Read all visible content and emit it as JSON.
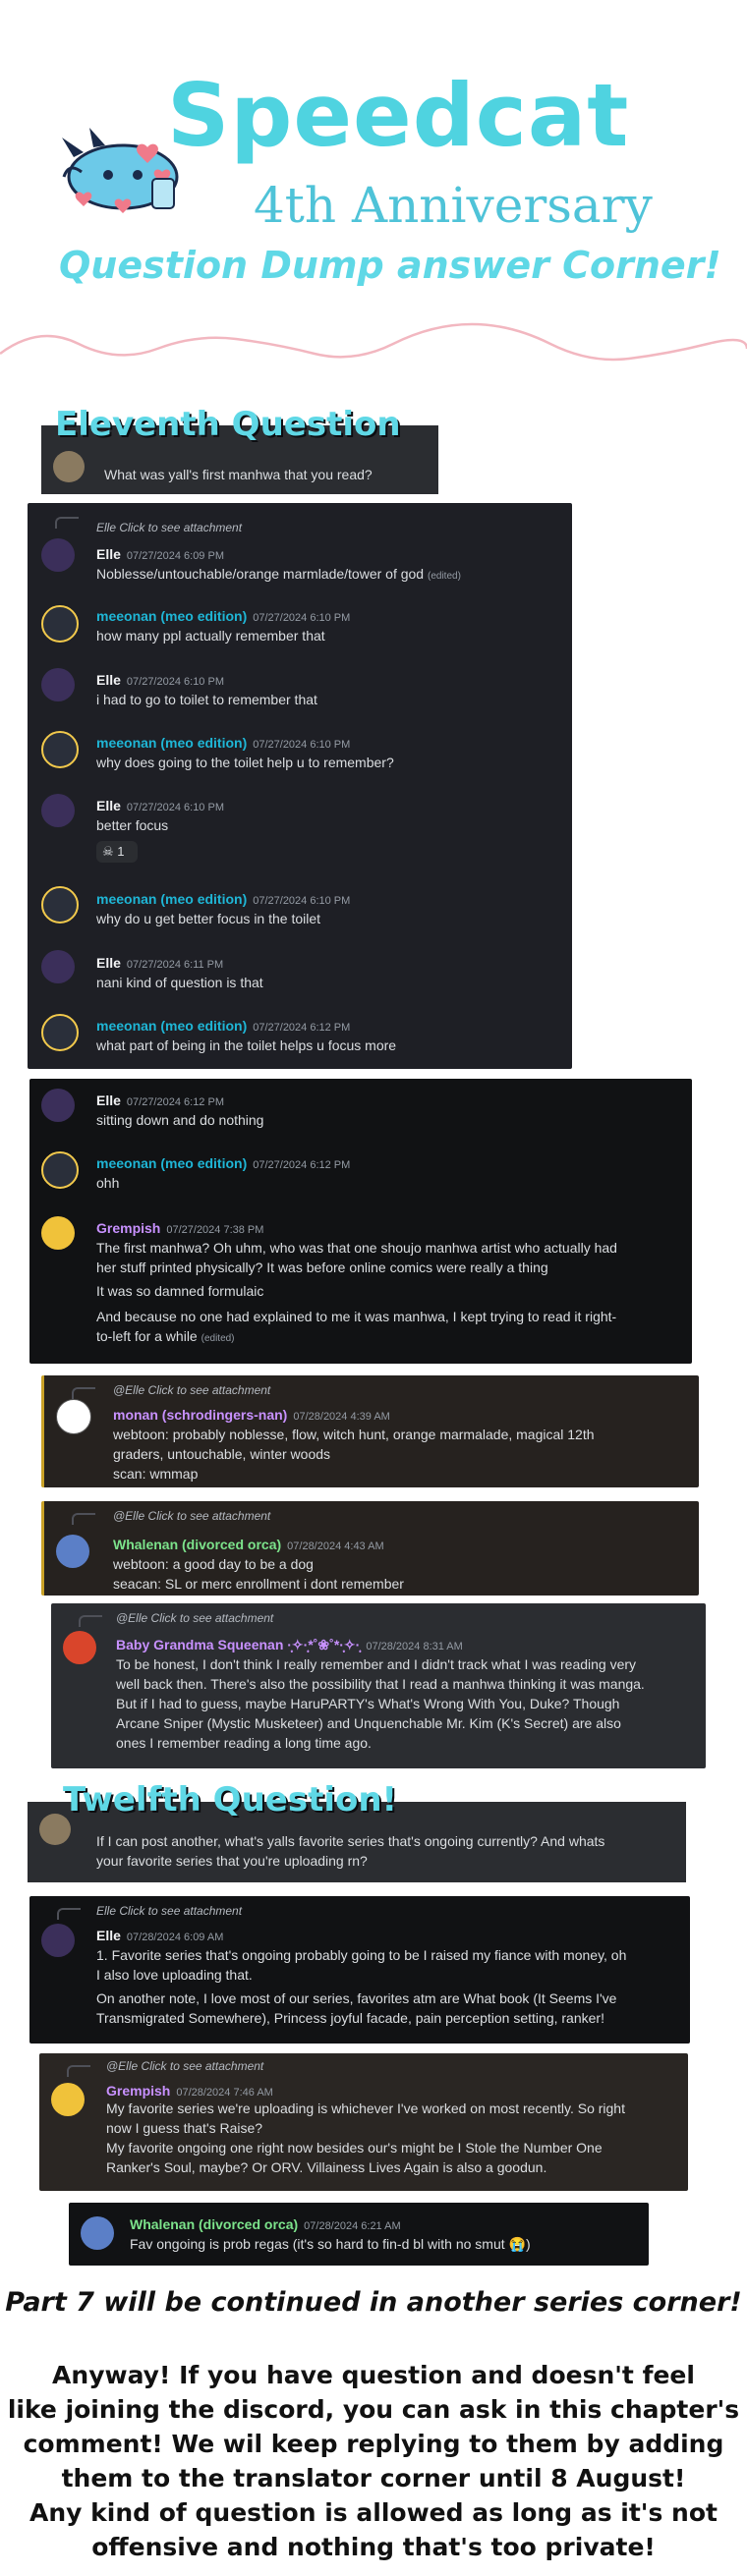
{
  "header": {
    "title": "Speedcat",
    "subtitle": "4th Anniversary",
    "tagline": "Question Dump answer Corner!"
  },
  "q11": {
    "heading": "Eleventh Question",
    "question": "What was yall's first manhwa that you read?"
  },
  "chat1": [
    {
      "reply": "Elle Click to see attachment",
      "name": "Elle",
      "time": "07/27/2024 6:09 PM",
      "text": "Noblesse/untouchable/orange marmlade/tower of god",
      "edited": "(edited)"
    },
    {
      "name": "meeonan (meo edition)",
      "time": "07/27/2024 6:10 PM",
      "text": "how many ppl actually remember that"
    },
    {
      "name": "Elle",
      "time": "07/27/2024 6:10 PM",
      "text": "i had to go to toilet to remember that"
    },
    {
      "name": "meeonan (meo edition)",
      "time": "07/27/2024 6:10 PM",
      "text": "why does going to the toilet help u to remember?"
    },
    {
      "name": "Elle",
      "time": "07/27/2024 6:10 PM",
      "text": "better focus",
      "reaction": "1"
    },
    {
      "name": "meeonan (meo edition)",
      "time": "07/27/2024 6:10 PM",
      "text": "why do u get better focus in the toilet"
    },
    {
      "name": "Elle",
      "time": "07/27/2024 6:11 PM",
      "text": "nani kind of question is that"
    },
    {
      "name": "meeonan (meo edition)",
      "time": "07/27/2024 6:12 PM",
      "text": "what part of being in the toilet helps u focus more"
    }
  ],
  "chat2": [
    {
      "name": "Elle",
      "time": "07/27/2024 6:12 PM",
      "text": "sitting down and do nothing"
    },
    {
      "name": "meeonan (meo edition)",
      "time": "07/27/2024 6:12 PM",
      "text": "ohh"
    },
    {
      "name": "Grempish",
      "time": "07/27/2024 7:38 PM",
      "lines": [
        "The first manhwa? Oh uhm, who was that one shoujo manhwa artist who actually had",
        "her stuff printed physically? It was before online comics were really a thing",
        "It was so damned formulaic",
        "And because no one had explained to me it was manhwa, I kept trying to read it right-",
        "to-left for a while"
      ],
      "edited": "(edited)"
    }
  ],
  "monan": {
    "reply": "@Elle Click to see attachment",
    "name": "monan (schrodingers-nan)",
    "time": "07/28/2024 4:39 AM",
    "lines": [
      "webtoon: probably noblesse, flow, witch hunt, orange marmalade, magical 12th",
      "graders, untouchable, winter woods",
      "scan: wmmap"
    ]
  },
  "whalenan1": {
    "reply": "@Elle Click to see attachment",
    "name": "Whalenan (divorced orca)",
    "time": "07/28/2024 4:43 AM",
    "lines": [
      "webtoon: a good day to be a dog",
      "seacan: SL or merc enrollment i dont remember"
    ]
  },
  "baby": {
    "reply": "@Elle Click to see attachment",
    "name": "Baby Grandma Squeenan ·̩͙✧·̩͙*˚❀˚*·̩͙✧·̩͙",
    "time": "07/28/2024 8:31 AM",
    "lines": [
      "To be honest, I don't think I really remember and I didn't track what I was reading very",
      "well back then. There's also the possibility that I read a manhwa thinking it was manga.",
      "But if I had to guess, maybe HaruPARTY's What's Wrong With You, Duke? Though",
      "Arcane Sniper (Mystic Musketeer) and Unquenchable Mr. Kim (K's Secret) are also",
      "ones I remember reading a long time ago."
    ]
  },
  "q12": {
    "heading": "Twelfth Question!",
    "question_lines": [
      "If I can post another, what's yalls favorite series that's ongoing currently? And whats",
      "your favorite series that you're uploading rn?"
    ]
  },
  "elle12": {
    "reply": "Elle Click to see attachment",
    "name": "Elle",
    "time": "07/28/2024 6:09 AM",
    "lines": [
      "1. Favorite series that's ongoing probably going to be I raised my fiance with money, oh",
      "    I also love uploading that.",
      "On another note, I love most of our series, favorites atm are What book (It Seems I've",
      "Transmigrated Somewhere), Princess joyful facade, pain perception setting, ranker!"
    ]
  },
  "grem12": {
    "reply": "@Elle Click to see attachment",
    "name": "Grempish",
    "time": "07/28/2024 7:46 AM",
    "lines": [
      "My favorite series we're uploading is whichever I've worked on most recently. So right",
      "now I guess that's Raise?",
      "My favorite ongoing one right now besides our's might be I Stole the Number One",
      "Ranker's Soul, maybe? Or ORV. Villainess Lives Again is also a goodun."
    ]
  },
  "whale12": {
    "name": "Whalenan (divorced orca)",
    "time": "07/28/2024 6:21 AM",
    "text": "Fav ongoing is prob regas (it's so hard to fin-d bl with no smut 😭)"
  },
  "footer": {
    "part": "Part 7 will be continued in another series corner!",
    "lines": [
      "Anyway! If you have question and doesn't feel",
      "like joining the discord, you can ask in this chapter's",
      "comment! We wil keep replying to them by adding",
      "them to the translator corner until 8 August!",
      "Any kind of question is allowed as long as it's not",
      "offensive and nothing that's too private!"
    ]
  }
}
